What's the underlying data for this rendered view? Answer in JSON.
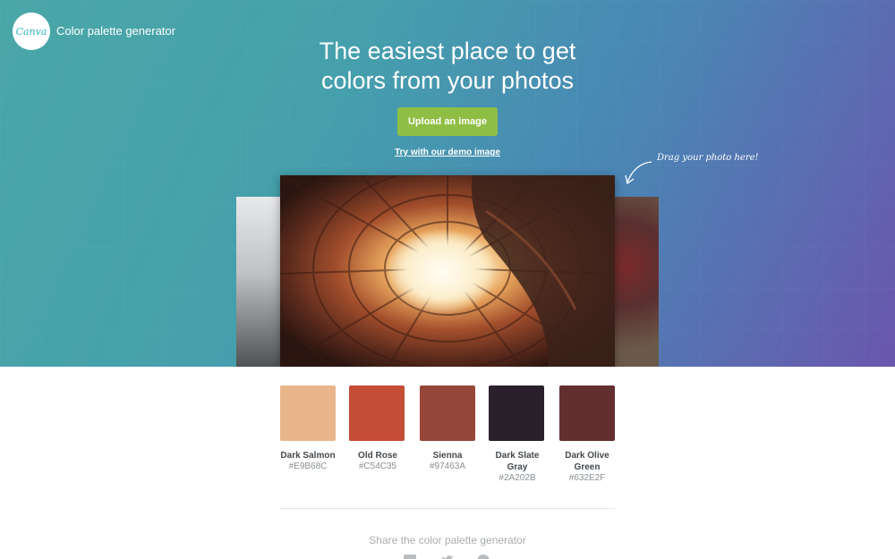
{
  "header": {
    "logo_text": "Canva",
    "app_title": "Color palette generator"
  },
  "hero": {
    "headline_line1": "The easiest place to get",
    "headline_line2": "colors from your photos",
    "upload_label": "Upload an image",
    "demo_link": "Try with our demo image",
    "drag_hint": "Drag your photo here!"
  },
  "palette": [
    {
      "name": "Dark Salmon",
      "hex": "#E9B68C",
      "color": "#E9B68C"
    },
    {
      "name": "Old Rose",
      "hex": "#C54C35",
      "color": "#C54C35"
    },
    {
      "name": "Sienna",
      "hex": "#97463A",
      "color": "#97463A"
    },
    {
      "name": "Dark Slate Gray",
      "hex": "#2A202B",
      "color": "#2A202B"
    },
    {
      "name": "Dark Olive Green",
      "hex": "#632E2F",
      "color": "#632E2F"
    }
  ],
  "share": {
    "title": "Share the color palette generator",
    "icons": [
      "facebook-icon",
      "twitter-icon",
      "pinterest-icon"
    ]
  },
  "colors": {
    "button": "#8FBE45",
    "hero_start": "#4AA7A7",
    "hero_end": "#6A56AD"
  }
}
